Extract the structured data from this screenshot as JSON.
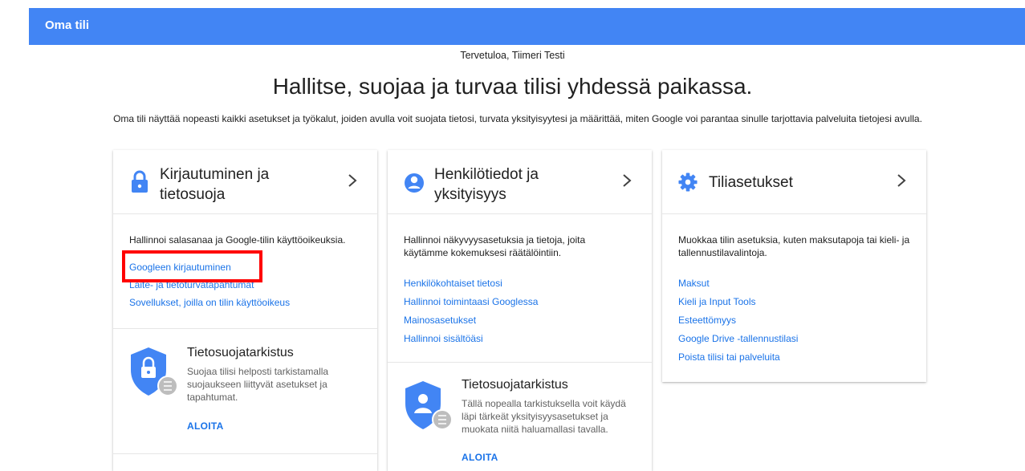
{
  "app": {
    "title": "Oma tili"
  },
  "header": {
    "welcome": "Tervetuloa, Tiimeri Testi",
    "headline": "Hallitse, suojaa ja turvaa tilisi yhdessä paikassa.",
    "subline": "Oma tili näyttää nopeasti kaikki asetukset ja työkalut, joiden avulla voit suojata tietosi, turvata yksityisyytesi ja määrittää, miten Google voi parantaa sinulle tarjottavia palveluita tietojesi avulla."
  },
  "cards": [
    {
      "title_line1": "Kirjautuminen ja",
      "title_line2": "tietosuoja",
      "icon": "lock-icon",
      "description": "Hallinnoi salasanaa ja Google-tilin käyttöoikeuksia.",
      "links": [
        "Googleen kirjautuminen",
        "Laite- ja tietoturvatapahtumat",
        "Sovellukset, joilla on tilin käyttöoikeus"
      ],
      "checkup": {
        "title": "Tietosuojatarkistus",
        "description": "Suojaa tilisi helposti tarkistamalla suojaukseen liittyvät asetukset ja tapahtumat.",
        "action": "ALOITA"
      }
    },
    {
      "title_line1": "Henkilötiedot ja",
      "title_line2": "yksityisyys",
      "icon": "person-icon",
      "description": "Hallinnoi näkyvyysasetuksia ja tietoja, joita käytämme kokemuksesi räätälöintiin.",
      "links": [
        "Henkilökohtaiset tietosi",
        "Hallinnoi toimintaasi Googlessa",
        "Mainosasetukset",
        "Hallinnoi sisältöäsi"
      ],
      "checkup": {
        "title": "Tietosuojatarkistus",
        "description": "Tällä nopealla tarkistuksella voit käydä läpi tärkeät yksityisyysasetukset ja muokata niitä haluamallasi tavalla.",
        "action": "ALOITA"
      }
    },
    {
      "title_line1": "Tiliasetukset",
      "icon": "gear-icon",
      "description": "Muokkaa tilin asetuksia, kuten maksutapoja tai kieli- ja tallennustilavalintoja.",
      "links": [
        "Maksut",
        "Kieli ja Input Tools",
        "Esteettömyys",
        "Google Drive -tallennustilasi",
        "Poista tilisi tai palveluita"
      ]
    }
  ],
  "colors": {
    "brand_bar": "#4285f4",
    "link": "#1a73e8",
    "highlight": "#ff0000"
  }
}
